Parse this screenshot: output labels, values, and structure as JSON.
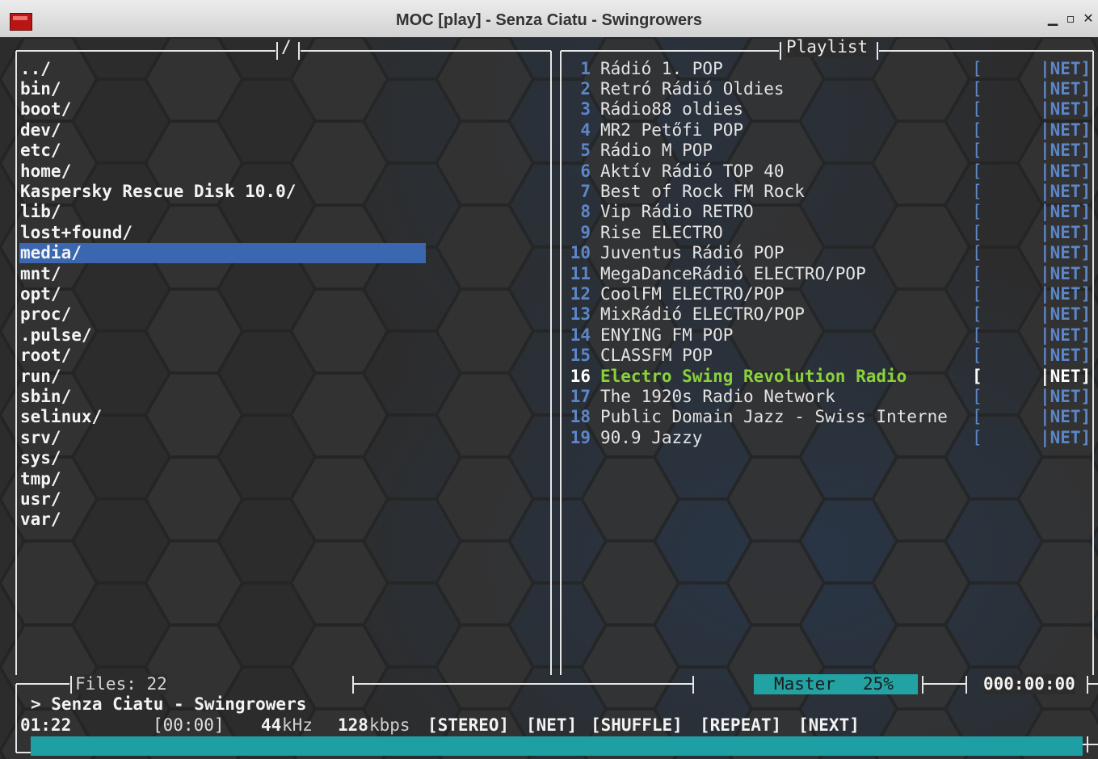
{
  "window": {
    "title": "MOC [play] - Senza Ciatu - Swingrowers",
    "minimize": "▁",
    "maximize": "▫",
    "close": "✕"
  },
  "left_panel": {
    "title": "/",
    "entries": [
      "../",
      "bin/",
      "boot/",
      "dev/",
      "etc/",
      "home/",
      "Kaspersky Rescue Disk 10.0/",
      "lib/",
      "lost+found/",
      "media/",
      "mnt/",
      "opt/",
      "proc/",
      ".pulse/",
      "root/",
      "run/",
      "sbin/",
      "selinux/",
      "srv/",
      "sys/",
      "tmp/",
      "usr/",
      "var/"
    ],
    "selected_index": 9,
    "files_label": "Files: 22"
  },
  "playlist": {
    "title": "Playlist",
    "items": [
      {
        "num": "1",
        "title": "Rádió 1. POP"
      },
      {
        "num": "2",
        "title": "Retró Rádió Oldies"
      },
      {
        "num": "3",
        "title": "Rádio88 oldies"
      },
      {
        "num": "4",
        "title": "MR2 Petőfi POP"
      },
      {
        "num": "5",
        "title": "Rádio M POP"
      },
      {
        "num": "6",
        "title": "Aktív Rádió TOP 40"
      },
      {
        "num": "7",
        "title": "Best of Rock FM Rock"
      },
      {
        "num": "8",
        "title": "Vip Rádio RETRO"
      },
      {
        "num": "9",
        "title": "Rise ELECTRO"
      },
      {
        "num": "10",
        "title": "Juventus Rádió POP"
      },
      {
        "num": "11",
        "title": "MegaDanceRádió ELECTRO/POP"
      },
      {
        "num": "12",
        "title": "CoolFM ELECTRO/POP"
      },
      {
        "num": "13",
        "title": "MixRádió ELECTRO/POP"
      },
      {
        "num": "14",
        "title": "ENYING FM POP"
      },
      {
        "num": "15",
        "title": "CLASSFM POP"
      },
      {
        "num": "16",
        "title": "Electro Swing Revolution Radio"
      },
      {
        "num": "17",
        "title": "The 1920s Radio Network"
      },
      {
        "num": "18",
        "title": "Public Domain Jazz - Swiss Interne"
      },
      {
        "num": "19",
        "title": "90.9 Jazzy"
      }
    ],
    "bracket": "[",
    "net": "|NET]",
    "playing_index": 15
  },
  "status": {
    "volume_label": "Master",
    "volume_pct": "25%",
    "volume_level": 0.25,
    "total_time": "000:00:00",
    "now_playing": "> Senza Ciatu - Swingrowers",
    "elapsed": "01:22",
    "remaining": "[00:00]",
    "rate_value": "44",
    "rate_unit": "kHz",
    "bitrate_value": "128",
    "bitrate_unit": "kbps",
    "flags": [
      "[STEREO]",
      "[NET]",
      "[SHUFFLE]",
      "[REPEAT]",
      "[NEXT]"
    ],
    "progress_fraction": 1.0
  },
  "colors": {
    "selection": "#3a67b0",
    "playing": "#8ad23c",
    "accent": "#22a2a2",
    "playlist_blue": "#5d86c8"
  }
}
